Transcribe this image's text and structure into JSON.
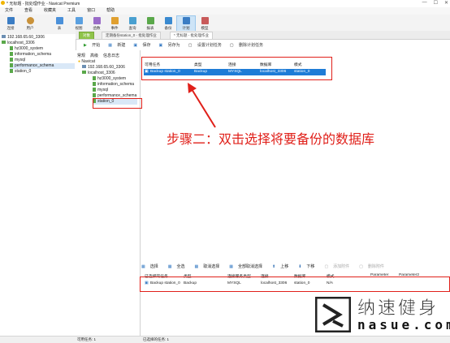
{
  "window": {
    "title": "* 无标题 - 批处理作业 - Navicat Premium",
    "min": "—",
    "max": "☐",
    "close": "✕"
  },
  "menu": [
    "文件",
    "查看",
    "收藏夹",
    "工具",
    "窗口",
    "帮助"
  ],
  "toolbar": [
    {
      "label": "连接",
      "icon": "plug-icon",
      "color": "#3b7dc4"
    },
    {
      "label": "用户",
      "icon": "user-icon",
      "color": "#c9923a"
    },
    {
      "label": "表",
      "icon": "table-icon",
      "color": "#4a90d9"
    },
    {
      "label": "视图",
      "icon": "view-icon",
      "color": "#5aa0e0"
    },
    {
      "label": "函数",
      "icon": "function-icon",
      "color": "#9a6cc8"
    },
    {
      "label": "事件",
      "icon": "event-icon",
      "color": "#e0a030"
    },
    {
      "label": "查询",
      "icon": "query-icon",
      "color": "#4aa0d0"
    },
    {
      "label": "报表",
      "icon": "report-icon",
      "color": "#5aa84a"
    },
    {
      "label": "备份",
      "icon": "backup-icon",
      "color": "#3a8ad0"
    },
    {
      "label": "计划",
      "icon": "schedule-icon",
      "color": "#3a7dc4"
    },
    {
      "label": "模型",
      "icon": "model-icon",
      "color": "#c85a5a"
    }
  ],
  "connections": {
    "items": [
      {
        "label": "192.168.65.60_3306",
        "type": "connection"
      },
      {
        "label": "localhost_3306",
        "type": "connection"
      },
      {
        "label": "hz3000_system",
        "type": "db"
      },
      {
        "label": "information_schema",
        "type": "db"
      },
      {
        "label": "mysql",
        "type": "db"
      },
      {
        "label": "performance_schema",
        "type": "db",
        "selected": true
      },
      {
        "label": "station_0",
        "type": "db"
      }
    ]
  },
  "tabs": {
    "objects": "对象",
    "tab2": "定期备份station_0 - 批处理作业",
    "tab3": "* 无标题 - 批处理作业"
  },
  "jobtoolbar": {
    "start": "开始",
    "new": "新建",
    "save": "保存",
    "saveas": "另存为",
    "set_schedule": "设置计划任务",
    "delete_schedule": "删除计划任务"
  },
  "midpane": {
    "tabs": [
      "常规",
      "高级",
      "信息日志"
    ],
    "items": [
      {
        "label": "Navicat",
        "type": "root"
      },
      {
        "label": "192.168.65.60_3306",
        "type": "connection"
      },
      {
        "label": "localhost_3306",
        "type": "connection"
      },
      {
        "label": "hz3000_system",
        "type": "db"
      },
      {
        "label": "information_schema",
        "type": "db"
      },
      {
        "label": "mysql",
        "type": "db"
      },
      {
        "label": "performance_schema",
        "type": "db"
      },
      {
        "label": "station_0",
        "type": "db",
        "selected": true
      }
    ]
  },
  "available": {
    "headers": [
      "可用任务",
      "类型",
      "连接",
      "数据库",
      "模式"
    ],
    "rows": [
      [
        "Backup station_0",
        "Backup",
        "MYSQL",
        "localhost_3306",
        "station_0"
      ]
    ]
  },
  "annotation": "步骤二：双击选择将要备份的数据库",
  "lowtoolbar": {
    "select": "选择",
    "select_all": "全选",
    "deselect": "取消选择",
    "deselect_all": "全部取消选择",
    "up": "上移",
    "down": "下移",
    "add_attachment": "添加附件",
    "delete_attachment": "删除附件"
  },
  "selected": {
    "headers": [
      "已选择的任务",
      "类型",
      "连接服务类型",
      "连接",
      "数据库",
      "模式",
      "Parameter",
      "Parameter2"
    ],
    "rows": [
      [
        "Backup station_0",
        "Backup",
        "MYSQL",
        "localhost_3306",
        "station_0",
        "N/A",
        "",
        ""
      ]
    ]
  },
  "status": {
    "available": "可用任务: 1",
    "selected": "已选择的任务: 1"
  },
  "watermark": {
    "cn": "纳速健身",
    "en": "nasue.com"
  }
}
